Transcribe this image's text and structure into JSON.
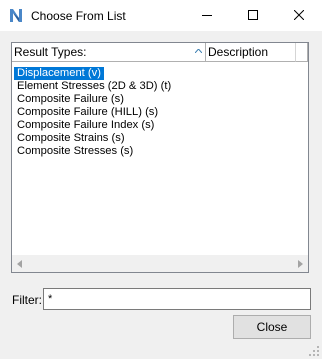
{
  "window": {
    "title": "Choose From List",
    "icon": "nx-logo-icon"
  },
  "list": {
    "columns": [
      {
        "label": "Result Types:",
        "sorted": "ascending"
      },
      {
        "label": "Description"
      }
    ],
    "items": [
      {
        "label": "Displacement (v)",
        "selected": true
      },
      {
        "label": "Element Stresses (2D & 3D) (t)"
      },
      {
        "label": "Composite Failure (s)"
      },
      {
        "label": "Composite Failure (HILL) (s)"
      },
      {
        "label": "Composite Failure Index (s)"
      },
      {
        "label": "Composite Strains (s)"
      },
      {
        "label": "Composite Stresses (s)"
      }
    ]
  },
  "filter": {
    "label": "Filter:",
    "value": "*"
  },
  "buttons": {
    "close": "Close"
  },
  "colors": {
    "selection": "#0078d7",
    "window_bg": "#f0f0f0"
  }
}
